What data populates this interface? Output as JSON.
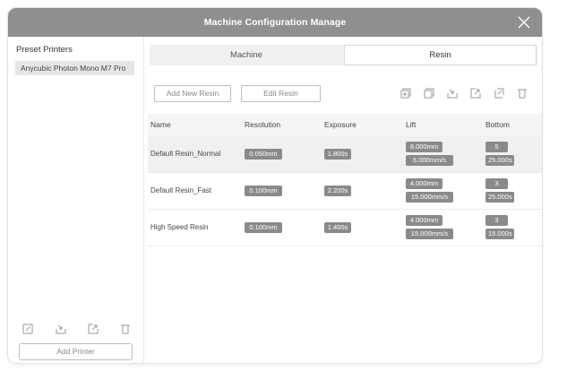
{
  "window": {
    "title": "Machine Configuration Manage"
  },
  "sidebar": {
    "title": "Preset Printers",
    "printers": [
      "Anycubic Photon Mono M7 Pro"
    ],
    "icons": [
      "edit-icon",
      "import-icon",
      "export-icon",
      "delete-icon"
    ],
    "add_printer_label": "Add Printer"
  },
  "tabs": [
    {
      "label": "Machine",
      "active": false
    },
    {
      "label": "Resin",
      "active": true
    }
  ],
  "toolbar": {
    "add_label": "Add New Resin",
    "edit_label": "Edit Resin",
    "icons": [
      "copy-icon",
      "duplicate-icon",
      "import-icon",
      "export-icon",
      "sync-icon",
      "delete-icon"
    ]
  },
  "table": {
    "headers": [
      "Name",
      "Resolution",
      "Exposure",
      "Lift",
      "Bottom"
    ],
    "rows": [
      {
        "name": "Default Resin_Normal",
        "resolution": "0.050mm",
        "exposure": "1.800s",
        "lift_height": "8.000mm",
        "lift_speed": "6.000mm/s",
        "bottom_layers": "5",
        "bottom_exposure": "25.000s",
        "selected": true
      },
      {
        "name": "Default Resin_Fast",
        "resolution": "0.100mm",
        "exposure": "2.200s",
        "lift_height": "4.000mm",
        "lift_speed": "15.000mm/s",
        "bottom_layers": "3",
        "bottom_exposure": "25.000s",
        "selected": false
      },
      {
        "name": "High Speed Resin",
        "resolution": "0.100mm",
        "exposure": "1.400s",
        "lift_height": "4.000mm",
        "lift_speed": "15.000mm/s",
        "bottom_layers": "3",
        "bottom_exposure": "15.000s",
        "selected": false
      }
    ]
  },
  "colors": {
    "titlebar": "#8f8f8f",
    "tag": "#8a8a8a",
    "selected_row": "#f0f0f0"
  }
}
